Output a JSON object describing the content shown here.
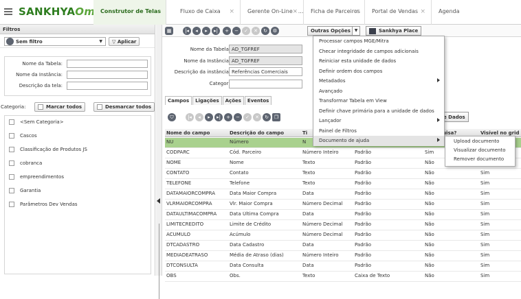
{
  "header": {
    "logo": "SANKHYA",
    "logo_suffix": "Om",
    "tabs": [
      {
        "label": "Construtor de Telas",
        "active": true
      },
      {
        "label": "Fluxo de Caixa",
        "close": "×"
      },
      {
        "label": "Gerente On-Line - ...",
        "close": "×"
      },
      {
        "label": "Ficha de Parceiros",
        "close": "×"
      },
      {
        "label": "Portal de Vendas",
        "close": "×"
      },
      {
        "label": "Agenda"
      }
    ]
  },
  "filters": {
    "title": "Filtros",
    "selected_filter": "Sem filtro",
    "apply_label": "Aplicar",
    "table_name_label": "Nome da Tabela:",
    "instance_name_label": "Nome da Instância:",
    "screen_desc_label": "Descrição da tela:",
    "category_label": "Categoria:",
    "check_all_label": "Marcar todos",
    "uncheck_all_label": "Desmarcar todos",
    "categories": [
      "<Sem Categoria>",
      "Cascos",
      "Classificação de Produtos JS",
      "cobranca",
      "empreendimentos",
      "Garantia",
      "Parâmetros Dev Vendas"
    ]
  },
  "toolbar": {
    "outras_label": "Outras Opções",
    "place_label": "Sankhya Place"
  },
  "form": {
    "table_label": "Nome da Tabela:",
    "table_value": "AD_TGFREF",
    "instance_label": "Nome da Instância:",
    "instance_value": "AD_TGFREF",
    "desc_label": "Descrição da instância:",
    "desc_value": "Referências Comerciais",
    "category_label": "Categoria:",
    "required_mark": "*"
  },
  "subtabs": [
    "Campos",
    "Ligações",
    "Ações",
    "Eventos"
  ],
  "grid": {
    "dados_label": "e Dados",
    "columns": [
      "Nome do campo",
      "Descrição do campo",
      "Ti",
      "",
      "e pesquisa?",
      "Visível no grid d"
    ],
    "rows": [
      [
        "NU",
        "Número",
        "N",
        "",
        "",
        ""
      ],
      [
        "CODPARC",
        "Cód. Parceiro",
        "Número Inteiro",
        "Padrão",
        "Sim",
        ""
      ],
      [
        "NOME",
        "Nome",
        "Texto",
        "Padrão",
        "Não",
        "Sim"
      ],
      [
        "CONTATO",
        "Contato",
        "Texto",
        "Padrão",
        "Não",
        "Sim"
      ],
      [
        "TELEFONE",
        "Telefone",
        "Texto",
        "Padrão",
        "Não",
        "Sim"
      ],
      [
        "DATAMAIORCOMPRA",
        "Data Maior Compra",
        "Data",
        "Padrão",
        "Não",
        "Sim"
      ],
      [
        "VLRMAIORCOMPRA",
        "Vlr. Maior Compra",
        "Número Decimal",
        "Padrão",
        "Não",
        "Sim"
      ],
      [
        "DATAULTIMACOMPRA",
        "Data Última Compra",
        "Data",
        "Padrão",
        "Não",
        "Sim"
      ],
      [
        "LIMITECREDITO",
        "Limite de Crédito",
        "Número Decimal",
        "Padrão",
        "Não",
        "Sim"
      ],
      [
        "ACUMULO",
        "Acúmulo",
        "Número Decimal",
        "Padrão",
        "Não",
        "Sim"
      ],
      [
        "DTCADASTRO",
        "Data Cadastro",
        "Data",
        "Padrão",
        "Não",
        "Sim"
      ],
      [
        "MEDIADEATRASO",
        "Média de Atraso (dias)",
        "Número Inteiro",
        "Padrão",
        "Não",
        "Sim"
      ],
      [
        "DTCONSULTA",
        "Data Consulta",
        "Data",
        "Padrão",
        "Não",
        "Sim"
      ],
      [
        "OBS",
        "Obs.",
        "Texto",
        "Caixa de Texto",
        "Não",
        "Sim"
      ]
    ]
  },
  "menu": {
    "items": [
      {
        "label": "Processar campos MGE/Mitra"
      },
      {
        "label": "Checar integridade de campos adicionais"
      },
      {
        "label": "Reiniciar esta unidade de dados"
      },
      {
        "label": "Definir ordem dos campos"
      },
      {
        "label": "Metadados",
        "submenu": true
      },
      {
        "label": "Avançado"
      },
      {
        "label": "Transformar Tabela em View"
      },
      {
        "label": "Definir chave primária para a unidade de dados"
      },
      {
        "label": "Lançador",
        "submenu": true
      },
      {
        "label": "Painel de Filtros"
      },
      {
        "label": "Documento de ajuda",
        "submenu": true,
        "highlight": true
      }
    ],
    "submenu": [
      "Upload documento",
      "Visualizar documento",
      "Remover documento"
    ]
  },
  "colors": {
    "brand": "#2e7d1f",
    "selected_row": "#a9d18e",
    "icon": "#5d6470"
  }
}
